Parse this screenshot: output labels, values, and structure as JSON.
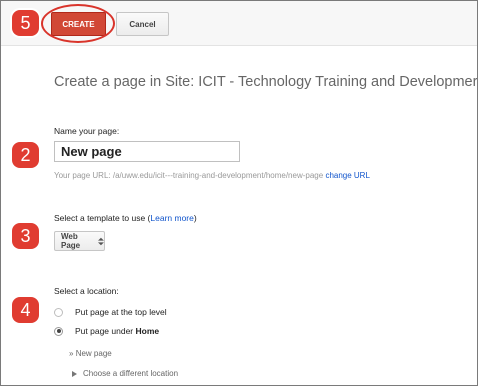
{
  "toolbar": {
    "create_label": "CREATE",
    "cancel_label": "Cancel",
    "step_label": "5"
  },
  "main": {
    "heading": "Create a page in Site: ICIT - Technology Training and Developmer"
  },
  "name_section": {
    "step_label": "2",
    "label": "Name your page:",
    "input_value": "New page",
    "url_prefix": "Your page URL: /a/uww.edu/icit---training-and-development/home/new-page",
    "change_url_link": "change URL"
  },
  "template_section": {
    "step_label": "3",
    "label_prefix": "Select a template to use (",
    "learn_more_link": "Learn more",
    "label_suffix": ")",
    "selected_template": "Web Page",
    "select_icon": "up-down-arrows-icon"
  },
  "location_section": {
    "step_label": "4",
    "label": "Select a location:",
    "option_top_level": "Put page at the top level",
    "option_under_prefix": "Put page under",
    "option_under_parent": "Home",
    "breadcrumb_prefix": "»",
    "breadcrumb_page": "New page",
    "choose_other_label": "Choose a different location"
  },
  "colors": {
    "create_button": "#d14836",
    "step_badge": "#e03c31",
    "link": "#1155cc"
  }
}
